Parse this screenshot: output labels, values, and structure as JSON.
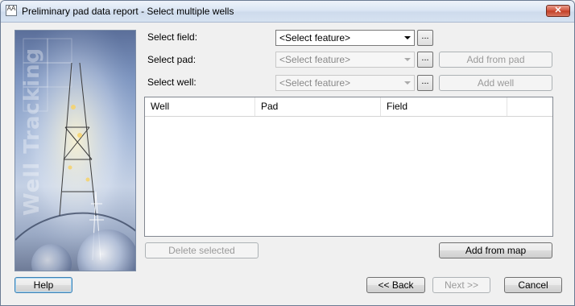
{
  "window": {
    "title": "Preliminary pad data report - Select multiple wells",
    "app_icon": "AA",
    "close_glyph": "✕"
  },
  "banner": {
    "text": "Well Tracking"
  },
  "form": {
    "field_label": "Select field:",
    "field_value": "<Select feature>",
    "pad_label": "Select pad:",
    "pad_value": "<Select feature>",
    "well_label": "Select well:",
    "well_value": "<Select feature>",
    "browse_label": "...",
    "add_from_pad": "Add from pad",
    "add_well": "Add well"
  },
  "table": {
    "columns": [
      "Well",
      "Pad",
      "Field",
      ""
    ]
  },
  "actions": {
    "delete_selected": "Delete selected",
    "add_from_map": "Add from map"
  },
  "footer": {
    "help": "Help",
    "back": "<< Back",
    "next": "Next >>",
    "cancel": "Cancel"
  }
}
